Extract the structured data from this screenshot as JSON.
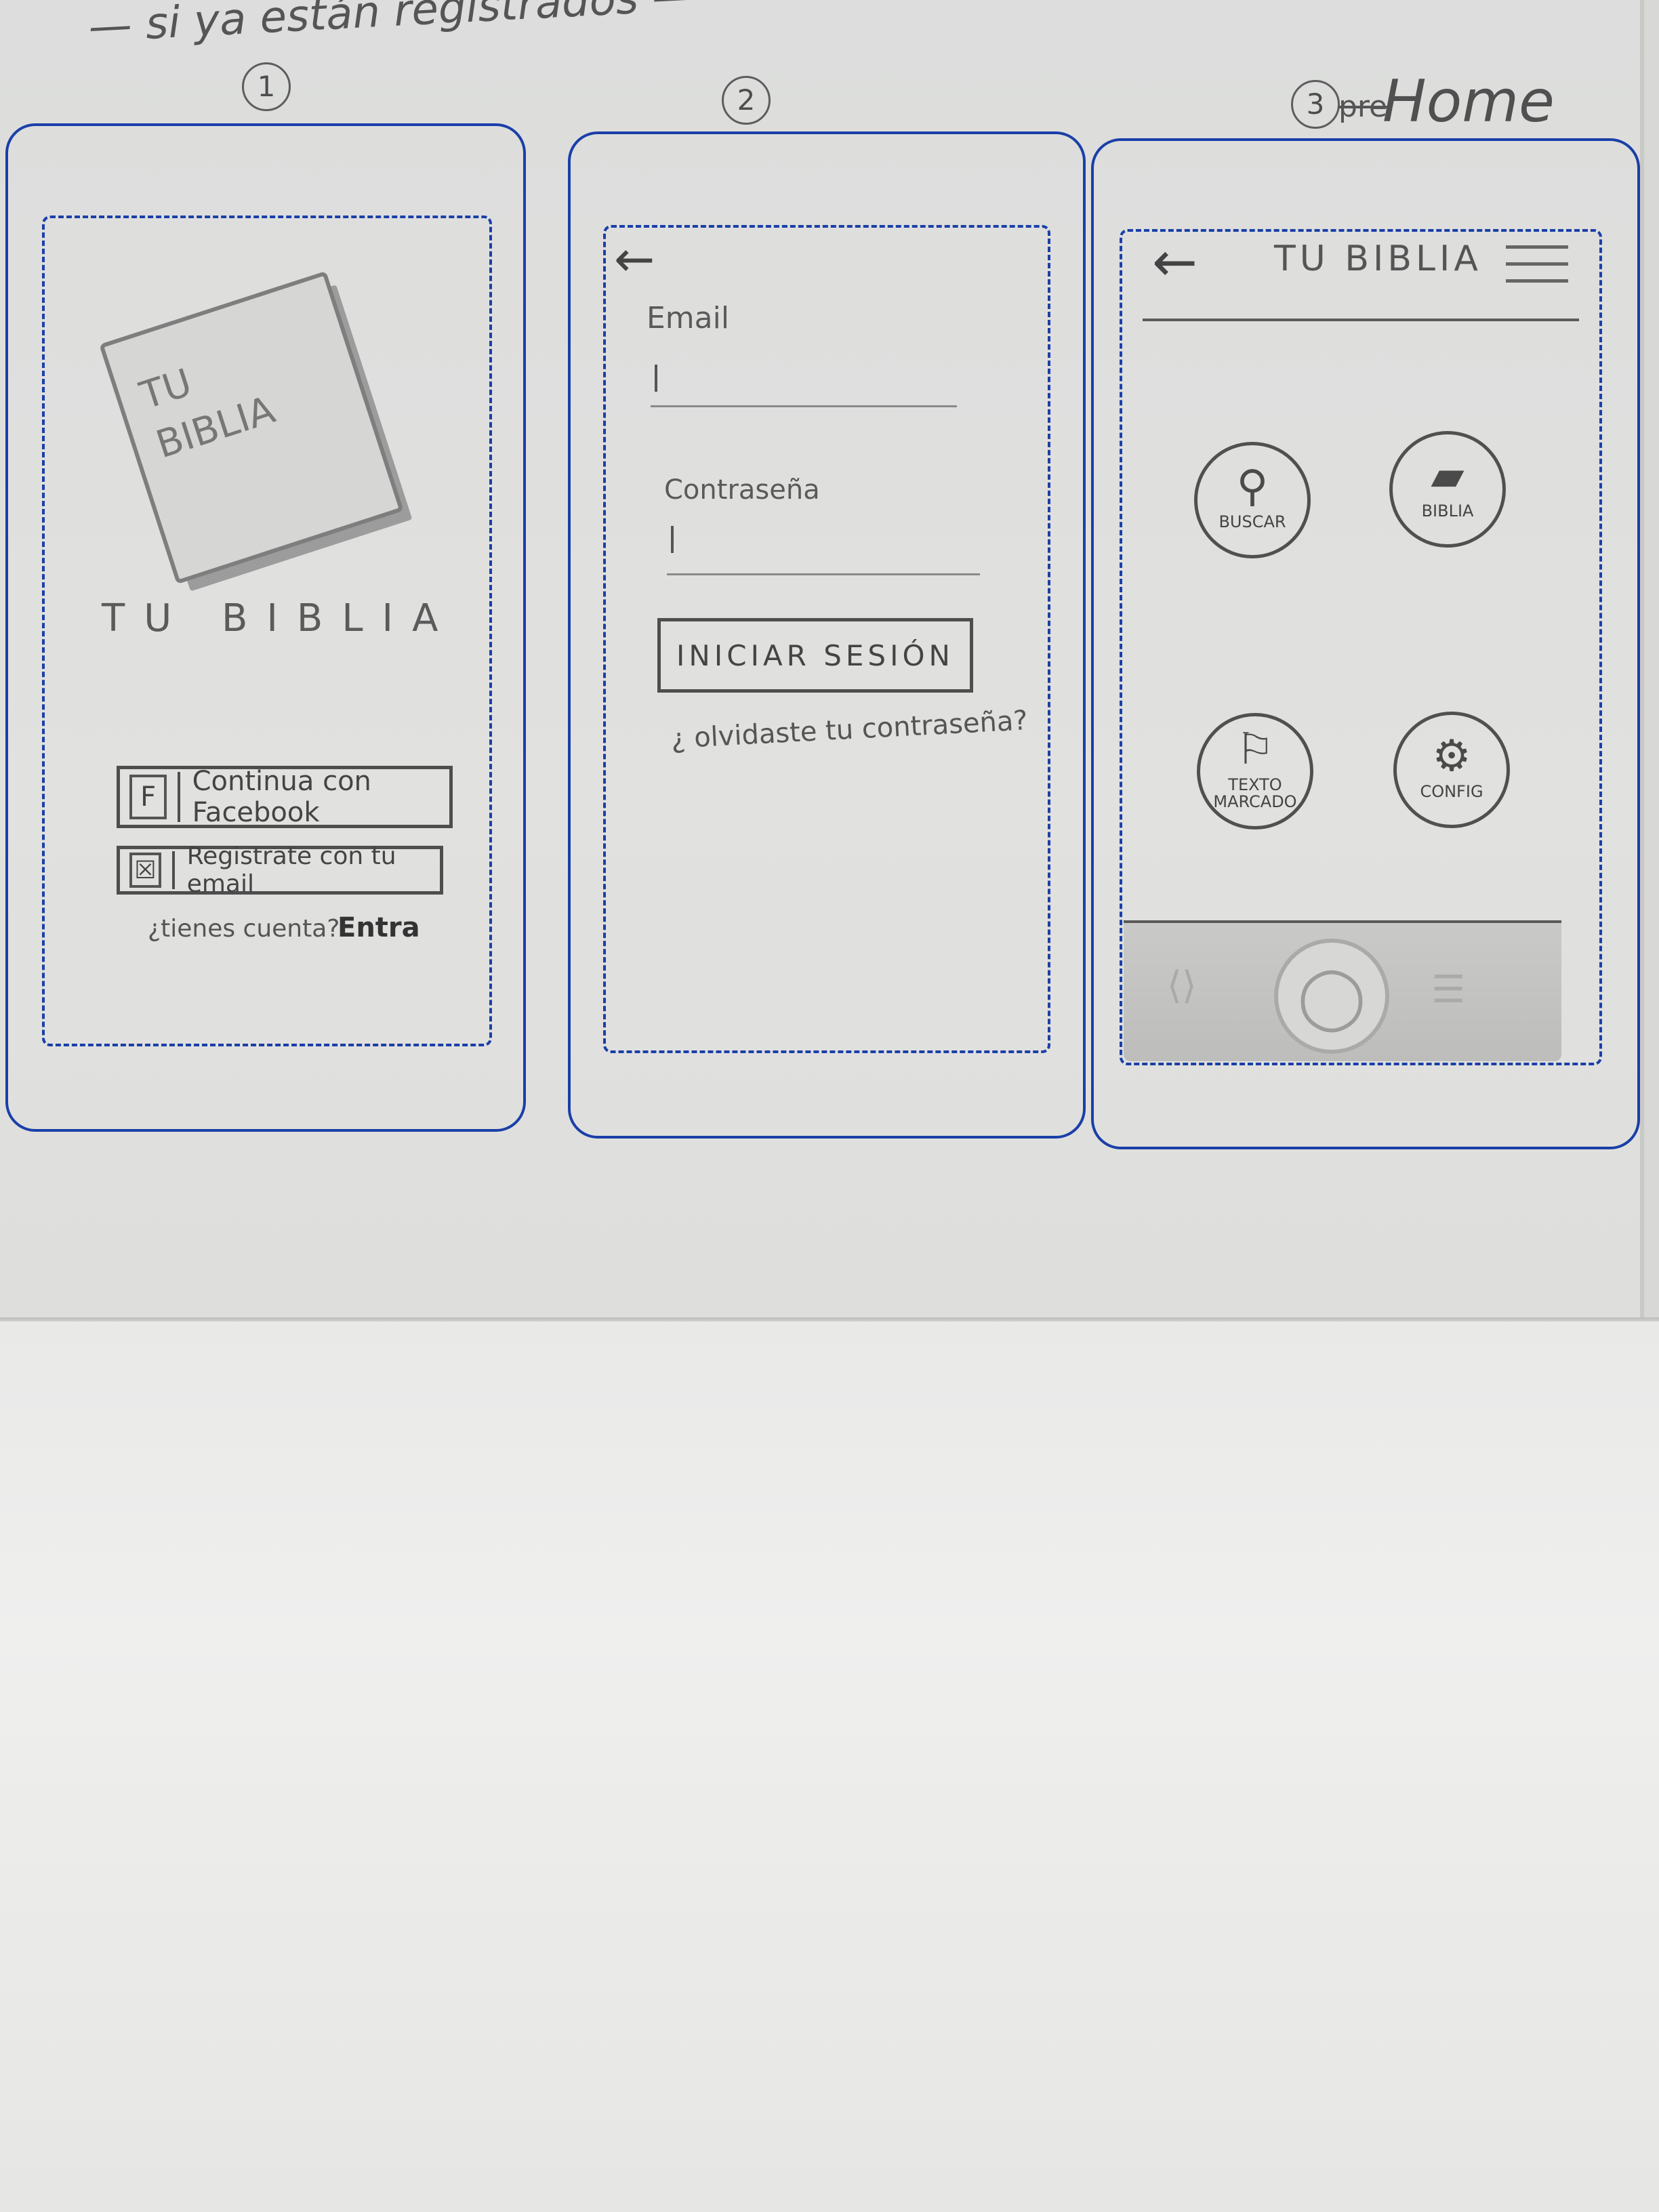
{
  "header": {
    "note": "— si ya están registrados —",
    "screen_numbers": [
      "1",
      "2",
      "3"
    ],
    "strike_word": "pre",
    "home_label": "Home"
  },
  "screen1": {
    "logo_text": "TU\nBIBLIA",
    "app_name": "TU BIBLIA",
    "facebook_icon": "F",
    "facebook_button": "Continua con Facebook",
    "email_icon": "☒",
    "email_button": "Registrate con tu email",
    "account_prompt": "¿tienes cuenta?",
    "login_link": "Entra"
  },
  "screen2": {
    "back_icon": "←",
    "email_label": "Email",
    "password_label": "Contraseña",
    "login_button": "INICIAR SESIÓN",
    "forgot_link": "¿ olvidaste tu contraseña?"
  },
  "screen3": {
    "back_icon": "←",
    "title": "TU BIBLIA",
    "tiles": [
      {
        "label": "BUSCAR",
        "icon": "search-icon",
        "glyph": "⚲"
      },
      {
        "label": "BIBLIA",
        "icon": "book-icon",
        "glyph": "▰"
      },
      {
        "label": "TEXTO\nMARCADO",
        "icon": "bookmark-icon",
        "glyph": "⚐"
      },
      {
        "label": "CONFIG",
        "icon": "gear-icon",
        "glyph": "⚙"
      }
    ],
    "home_glyph": "◯",
    "left_bar_glyph": "⟨⟩",
    "right_bar_glyph": "☰"
  },
  "colors": {
    "frame_ink": "#1a3fa8",
    "pencil": "#4a4a4a"
  }
}
